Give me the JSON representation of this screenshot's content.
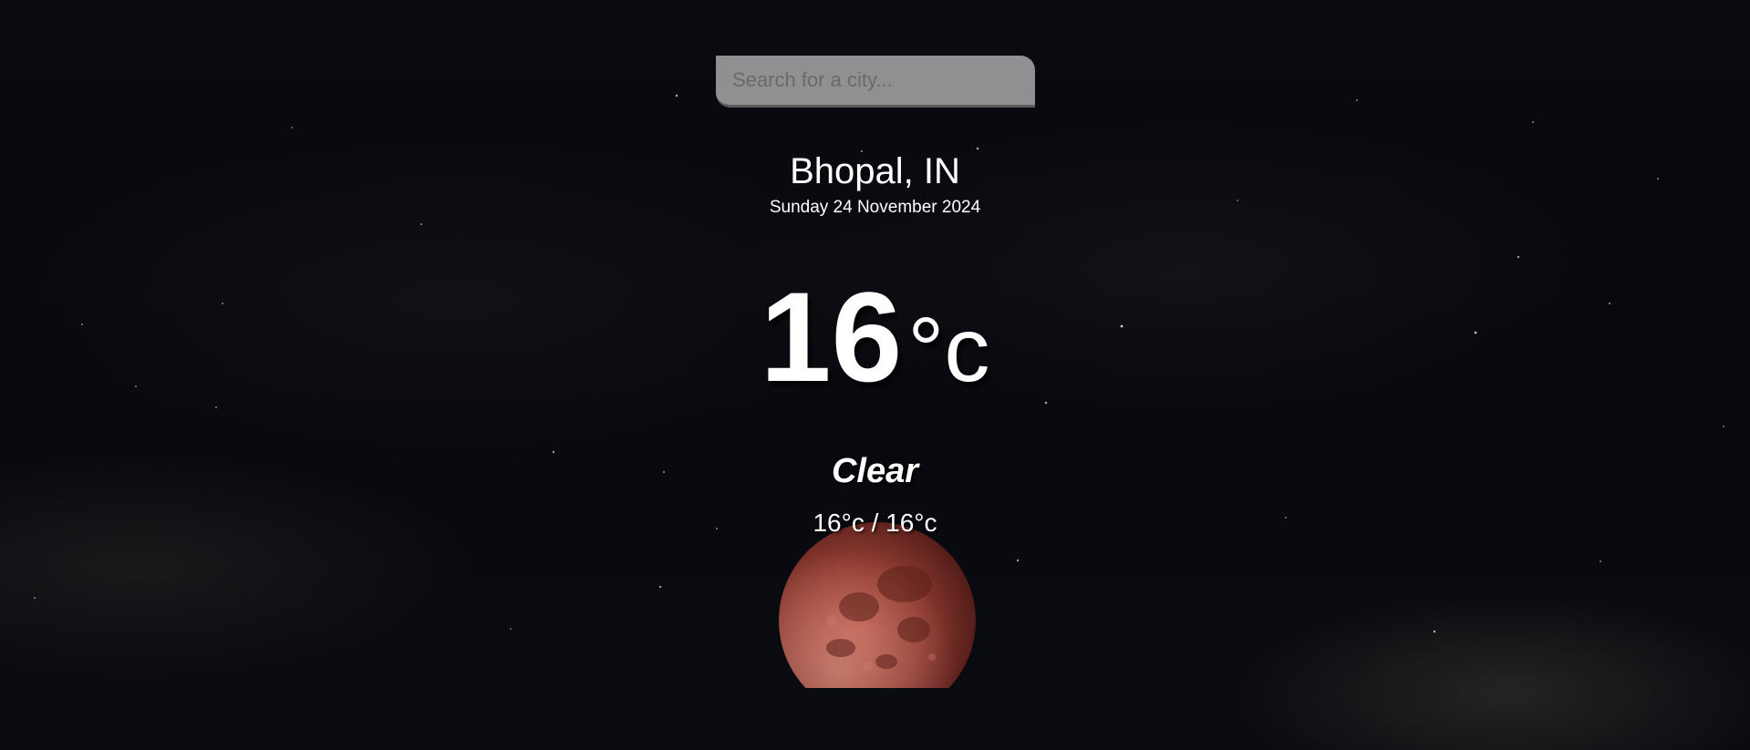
{
  "search": {
    "placeholder": "Search for a city...",
    "value": ""
  },
  "location": {
    "city": "Bhopal, IN",
    "date": "Sunday 24 November 2024"
  },
  "current": {
    "temperature": "16",
    "unit": "°c"
  },
  "weather": {
    "condition": "Clear",
    "hi_low": "16°c / 16°c"
  },
  "colors": {
    "background": "#08090e",
    "text": "#ffffff",
    "moon": "#8a3a2e"
  },
  "icons": {
    "moon": "blood-moon-image"
  }
}
